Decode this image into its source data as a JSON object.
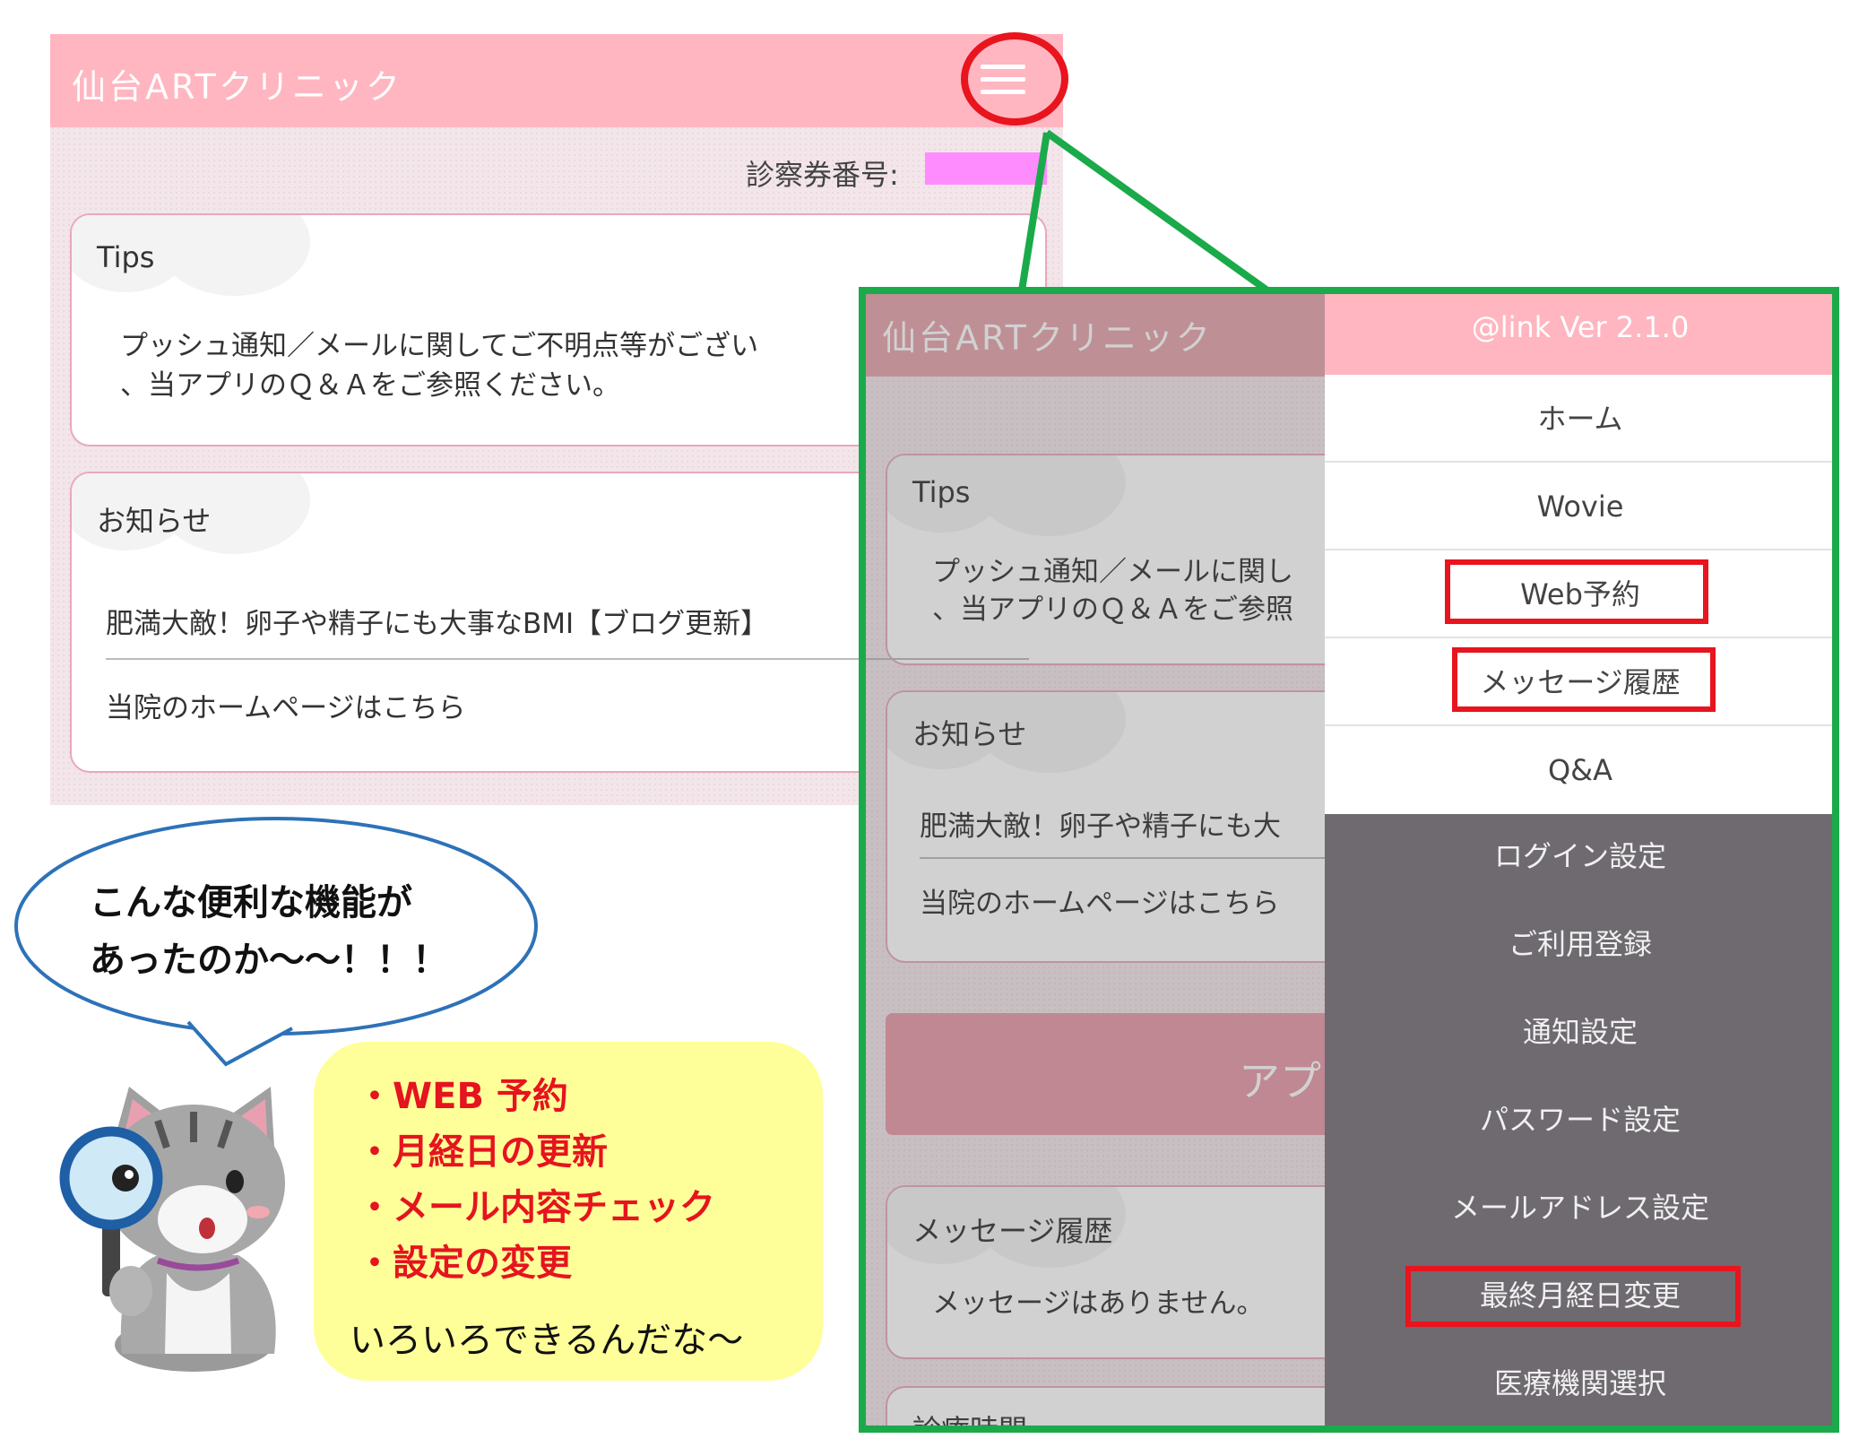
{
  "left": {
    "app_title": "仙台ARTクリニック",
    "ticket_label": "診察券番号:",
    "tips": {
      "title": "Tips",
      "line1": "プッシュ通知／メールに関してご不明点等がござい",
      "line2": "、当アプリのＱ＆Ａをご参照ください。"
    },
    "notice": {
      "title": "お知らせ",
      "item1": "肥満大敵！卵子や精子にも大事なBMI【ブログ更新】",
      "item2": "当院のホームページはこちら"
    }
  },
  "right": {
    "app_title": "仙台ARTクリニック",
    "tips": {
      "title": "Tips",
      "line1": "プッシュ通知／メールに関し",
      "line2": "、当アプリのＱ＆Ａをご参照"
    },
    "notice": {
      "title": "お知らせ",
      "item1": "肥満大敵！卵子や精子にも大",
      "item2": "当院のホームページはこちら"
    },
    "banner_text": "アプ",
    "messages": {
      "title": "メッセージ履歴",
      "empty": "メッセージはありません。"
    },
    "next_section_title": "診療時間"
  },
  "drawer": {
    "version": "@link Ver 2.1.0",
    "primary_items": [
      "ホーム",
      "Wovie",
      "Web予約",
      "メッセージ履歴",
      "Q&A"
    ],
    "settings_items": [
      "ログイン設定",
      "ご利用登録",
      "通知設定",
      "パスワード設定",
      "メールアドレス設定",
      "最終月経日変更",
      "医療機関選択"
    ]
  },
  "callout": {
    "speech_line1": "こんな便利な機能が",
    "speech_line2": "あったのか～～！！！",
    "features": [
      "・WEB 予約",
      "・月経日の更新",
      "・メール内容チェック",
      "・設定の変更"
    ],
    "footer": "いろいろできるんだな～"
  },
  "colors": {
    "header_pink": "#ffb6c1",
    "highlight_red": "#e8141e",
    "frame_green": "#1aaa4a",
    "drawer_dark": "#6e6a70",
    "note_yellow": "#ffff99"
  }
}
